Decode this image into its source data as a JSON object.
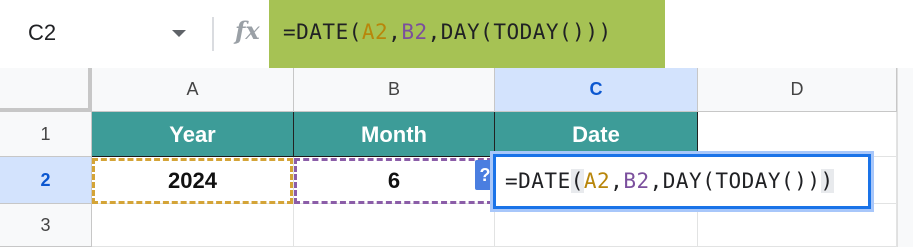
{
  "name_box": {
    "cell_ref": "C2"
  },
  "formula_bar": {
    "fx_label": "fx",
    "prefix": "=DATE(",
    "arg1": "A2",
    "comma1": ",",
    "arg2": "B2",
    "suffix": ",DAY(TODAY()))"
  },
  "columns": [
    "A",
    "B",
    "C",
    "D"
  ],
  "rows": [
    "1",
    "2",
    "3"
  ],
  "cells": {
    "A1": "Year",
    "B1": "Month",
    "C1": "Date",
    "A2": "2024",
    "B2": "6"
  },
  "editor": {
    "prefix": "=DATE",
    "open_paren": "(",
    "arg1": "A2",
    "comma1": ",",
    "arg2": "B2",
    "middle": ",DAY(TODAY())",
    "close_paren": ")",
    "help_label": "?"
  },
  "colors": {
    "header_fill": "#3d9c98",
    "formula_highlight": "#a6c254",
    "ref_a": "#b8860b",
    "ref_b": "#7b4f9d",
    "selection": "#1a73e8"
  }
}
